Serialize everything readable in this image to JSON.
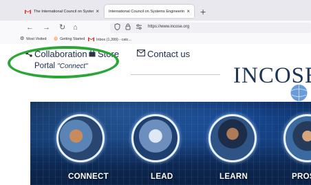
{
  "browser": {
    "tabs": [
      {
        "title": "The International Council on Systems Engineeri",
        "close": "×"
      },
      {
        "title": "International Council on Systems Engineering Websi",
        "close": "×"
      }
    ],
    "new_tab": "+",
    "nav": {
      "back": "←",
      "forward": "→",
      "reload": "↻",
      "home": "⌂"
    },
    "url": "https://www.incose.org",
    "bookmarks": [
      {
        "label": "Most Visited"
      },
      {
        "label": "Getting Started"
      },
      {
        "label": "Inbox (1,399) - catc..."
      }
    ]
  },
  "site": {
    "nav": {
      "collaboration": "Collaboration",
      "portal": "Portal",
      "connect": "\"Connect\"",
      "store": "Store",
      "contact": "Contact us"
    },
    "logo": "INCOSE"
  },
  "hero": {
    "labels": [
      "CONNECT",
      "LEAD",
      "LEARN",
      "PROS"
    ]
  },
  "colors": {
    "highlight": "#2aa637",
    "nav_text": "#1b2a49",
    "logo": "#1c3557"
  }
}
